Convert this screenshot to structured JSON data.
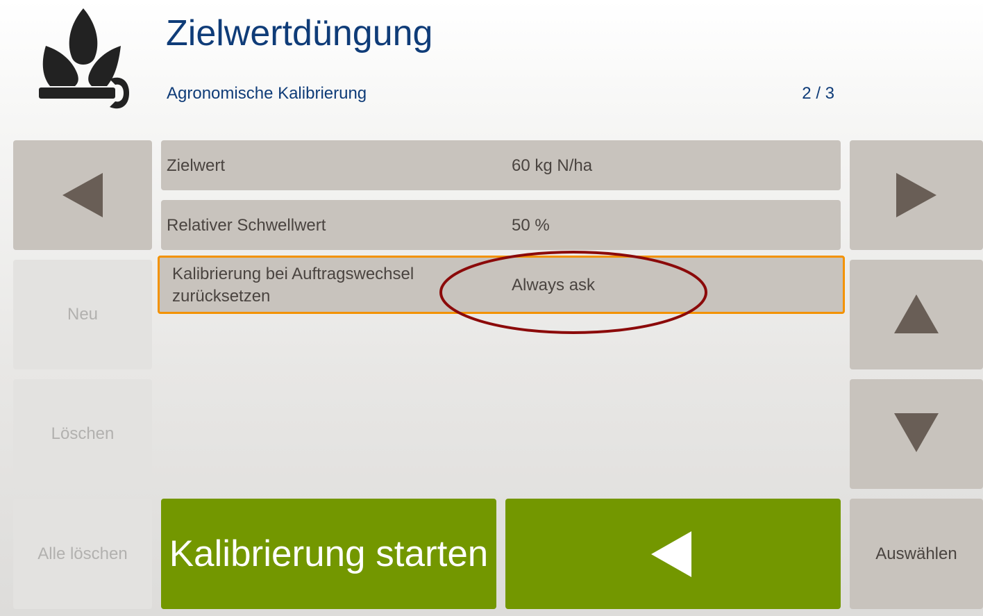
{
  "header": {
    "app_icon": "plant-wrench-icon",
    "title": "Zielwertdüngung",
    "subtitle": "Agronomische Kalibrierung",
    "page_indicator": "2 / 3"
  },
  "left_buttons": {
    "prev_icon": "arrow-left-icon",
    "new_label": "Neu",
    "delete_label": "Löschen",
    "delete_all_label": "Alle löschen"
  },
  "right_buttons": {
    "next_icon": "arrow-right-icon",
    "up_icon": "arrow-up-icon",
    "down_icon": "arrow-down-icon",
    "select_label": "Auswählen"
  },
  "parameters": [
    {
      "label": "Zielwert",
      "value": "60 kg N/ha"
    },
    {
      "label": "Relativer Schwellwert",
      "value": "50 %"
    },
    {
      "label_line1": "Kalibrierung bei Auftragswechsel",
      "label_line2": "zurücksetzen",
      "value": "Always ask",
      "selected": true
    }
  ],
  "bottom": {
    "start_label": "Kalibrierung starten",
    "back_icon": "back-arrow-icon"
  },
  "colors": {
    "title_blue": "#0f3c78",
    "row_gray": "#c8c3bd",
    "selection_orange": "#f39200",
    "action_green": "#739700",
    "annotation_red": "#8b0a0a",
    "arrow_brown": "#695e56"
  }
}
